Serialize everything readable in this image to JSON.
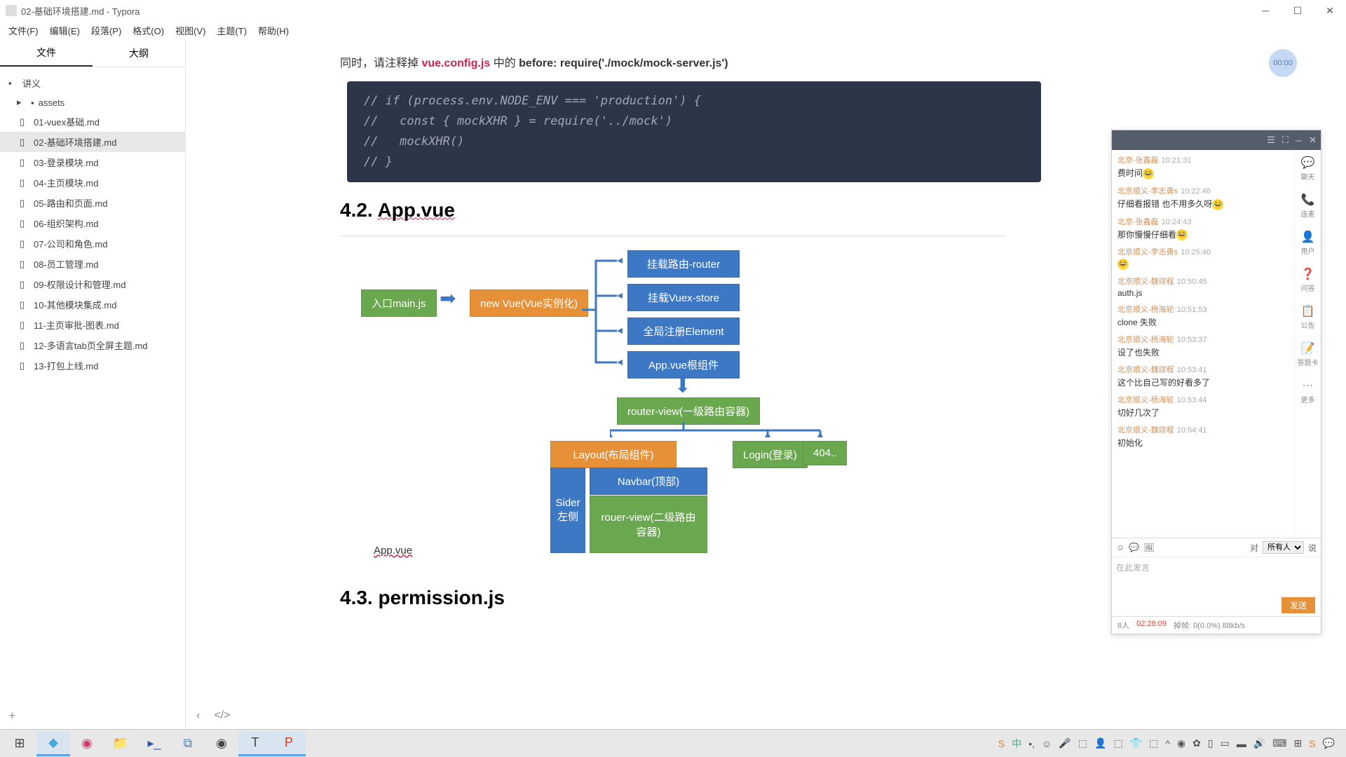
{
  "window": {
    "title": "02-基础环境搭建.md - Typora"
  },
  "menu": [
    "文件(F)",
    "编辑(E)",
    "段落(P)",
    "格式(O)",
    "视图(V)",
    "主题(T)",
    "帮助(H)"
  ],
  "sidebar": {
    "tabs": [
      "文件",
      "大纲"
    ],
    "root": "讲义",
    "folder": "assets",
    "files": [
      "01-vuex基础.md",
      "02-基础环境搭建.md",
      "03-登录模块.md",
      "04-主页模块.md",
      "05-路由和页面.md",
      "06-组织架构.md",
      "07-公司和角色.md",
      "08-员工管理.md",
      "09-权限设计和管理.md",
      "10-其他模块集成.md",
      "11-主页审批-图表.md",
      "12-多语言tab页全屏主题.md",
      "13-打包上线.md"
    ]
  },
  "content": {
    "intro_pre": "同时，请注释掉 ",
    "intro_red": "vue.config.js",
    "intro_mid": " 中的  ",
    "intro_bold": "before: require('./mock/mock-server.js')",
    "code": "// if (process.env.NODE_ENV === 'production') {\n//   const { mockXHR } = require('../mock')\n//   mockXHR()\n// }",
    "h42_num": "4.2. ",
    "h42_title": "App.vue",
    "h43": "4.3. permission.js",
    "diagram": {
      "entry": "入口main.js",
      "newvue": "new Vue(Vue实例化)",
      "router": "挂载路由-router",
      "vuex": "挂载Vuex-store",
      "element": "全局注册Element",
      "approot": "App.vue根组件",
      "routerview": "router-view(一级路由容器)",
      "layout": "Layout(布局组件)",
      "login": "Login(登录)",
      "notfound": "404..",
      "sider": "Sider\n左侧",
      "navbar": "Navbar(顶部)",
      "routerview2": "rouer-view(二级路由容器)",
      "applabel": "App.vue"
    },
    "timer": "00:00"
  },
  "chat": {
    "tab_title": "…",
    "side": [
      {
        "icon": "💬",
        "label": "聊天"
      },
      {
        "icon": "📞",
        "label": "连麦"
      },
      {
        "icon": "👤",
        "label": "用户"
      },
      {
        "icon": "❓",
        "label": "问答"
      },
      {
        "icon": "📋",
        "label": "公告"
      },
      {
        "icon": "📝",
        "label": "答题卡"
      },
      {
        "icon": "⋯",
        "label": "更多"
      }
    ],
    "messages": [
      {
        "user": "北京-张鑫磊",
        "time": "10:21:31",
        "text": "费时间",
        "emoji": true
      },
      {
        "user": "北京顺义-李志勇s",
        "time": "10:22:46",
        "text": "仔细看报错     也不用多久呀",
        "emoji": true
      },
      {
        "user": "北京-张鑫磊",
        "time": "10:24:43",
        "text": "那你慢慢仔细看",
        "emoji": true
      },
      {
        "user": "北京顺义-李志勇s",
        "time": "10:25:40",
        "text": "",
        "emoji": true
      },
      {
        "user": "北京顺义-魏琮程",
        "time": "10:50:45",
        "text": "auth.js"
      },
      {
        "user": "北京顺义-杨海轮",
        "time": "10:51:53",
        "text": "clone 失败"
      },
      {
        "user": "北京顺义-杨海轮",
        "time": "10:53:37",
        "text": "设了也失败"
      },
      {
        "user": "北京顺义-魏琮程",
        "time": "10:53:41",
        "text": "这个比自己写的好看多了"
      },
      {
        "user": "北京顺义-杨海轮",
        "time": "10:53:44",
        "text": "切好几次了"
      },
      {
        "user": "北京顺义-魏琮程",
        "time": "10:54:41",
        "text": "初始化"
      }
    ],
    "to": "对",
    "everyone": "所有人",
    "say": "说",
    "placeholder": "在此发言",
    "send": "发送",
    "footer_count": "8人",
    "footer_time": "02:28:09",
    "footer_stats": "掉帧: 0(0.0%) 88kb/s"
  }
}
